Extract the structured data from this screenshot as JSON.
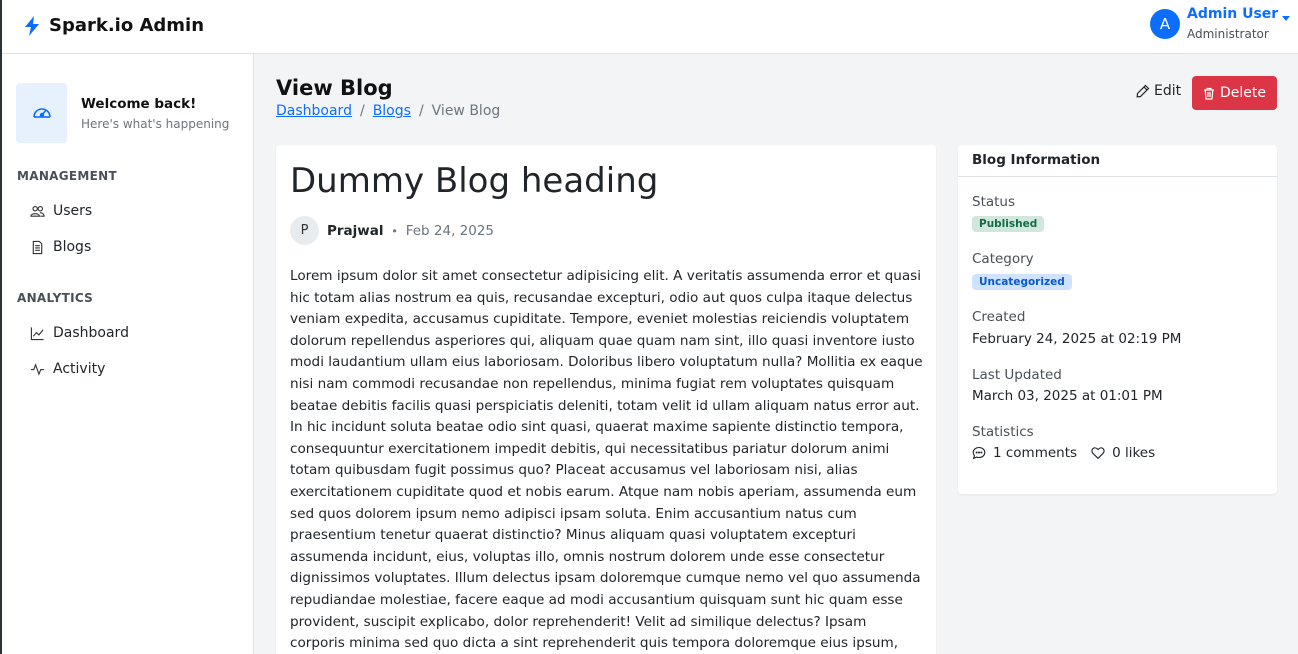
{
  "app": {
    "brand": "Spark.io Admin"
  },
  "user": {
    "initial": "A",
    "name": "Admin User",
    "role": "Administrator"
  },
  "sidebar": {
    "welcome_title": "Welcome back!",
    "welcome_subtitle": "Here's what's happening",
    "sections": [
      {
        "title": "MANAGEMENT",
        "items": [
          {
            "label": "Users",
            "icon": "users-icon"
          },
          {
            "label": "Blogs",
            "icon": "document-icon"
          }
        ]
      },
      {
        "title": "ANALYTICS",
        "items": [
          {
            "label": "Dashboard",
            "icon": "chart-line-icon"
          },
          {
            "label": "Activity",
            "icon": "activity-icon"
          }
        ]
      }
    ]
  },
  "page": {
    "title": "View Blog",
    "breadcrumb": [
      "Dashboard",
      "Blogs",
      "View Blog"
    ],
    "edit_label": "Edit",
    "delete_label": "Delete"
  },
  "post": {
    "title": "Dummy Blog heading",
    "author_initial": "P",
    "author": "Prajwal",
    "date": "Feb 24, 2025",
    "body": "Lorem ipsum dolor sit amet consectetur adipisicing elit. A veritatis assumenda error et quasi hic totam alias nostrum ea quis, recusandae excepturi, odio aut quos culpa itaque delectus veniam expedita, accusamus cupiditate. Tempore, eveniet molestias reiciendis voluptatem dolorum repellendus asperiores qui, aliquam quae quam nam sint, illo quasi inventore iusto modi laudantium ullam eius laboriosam. Doloribus libero voluptatum nulla? Mollitia ex eaque nisi nam commodi recusandae non repellendus, minima fugiat rem voluptates quisquam beatae debitis facilis quasi perspiciatis deleniti, totam velit id ullam aliquam natus error aut. In hic incidunt soluta beatae odio sint quasi, quaerat maxime sapiente distinctio tempora, consequuntur exercitationem impedit debitis, qui necessitatibus pariatur dolorum animi totam quibusdam fugit possimus quo? Placeat accusamus vel laboriosam nisi, alias exercitationem cupiditate quod et nobis earum. Atque nam nobis aperiam, assumenda eum sed quos dolorem ipsum nemo adipisci ipsam soluta. Enim accusantium natus cum praesentium tenetur quaerat distinctio? Minus aliquam quasi voluptatem excepturi assumenda incidunt, eius, voluptas illo, omnis nostrum dolorem unde esse consectetur dignissimos voluptates. Illum delectus ipsam doloremque cumque nemo vel quo assumenda repudiandae molestiae, facere eaque ad modi accusantium quisquam sunt hic quam esse provident, suscipit explicabo, dolor reprehenderit! Velit ad similique delectus? Ipsam corporis minima sed quo dicta a sint reprehenderit quis tempora doloremque eius ipsum, tenetur voluptas autem incidunt! Omnis eveniet nobis, vitae laudantium"
  },
  "info": {
    "heading": "Blog Information",
    "status_label": "Status",
    "status": "Published",
    "category_label": "Category",
    "category": "Uncategorized",
    "created_label": "Created",
    "created": "February 24, 2025 at 02:19 PM",
    "updated_label": "Last Updated",
    "updated": "March 03, 2025 at 01:01 PM",
    "stats_label": "Statistics",
    "comments": "1 comments",
    "likes": "0 likes"
  },
  "colors": {
    "primary": "#0d6efd",
    "danger": "#dc3545",
    "success_bg": "#d1e7dd",
    "info_bg": "#cfe2ff"
  }
}
